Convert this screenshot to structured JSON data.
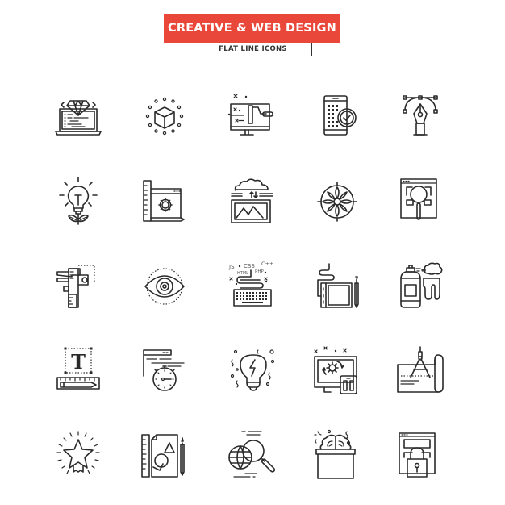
{
  "header": {
    "title": "CREATIVE & WEB DESIGN",
    "subtitle": "FLAT LINE ICONS",
    "accent_color": "#e8473a"
  },
  "icons": [
    {
      "name": "laptop-diamond-code-icon"
    },
    {
      "name": "cube-dots-icon"
    },
    {
      "name": "monitor-paint-roller-icon"
    },
    {
      "name": "phone-grid-check-icon"
    },
    {
      "name": "pen-tool-bezier-icon"
    },
    {
      "name": "lightbulb-plant-icon"
    },
    {
      "name": "ruler-window-gear-icon"
    },
    {
      "name": "cloud-image-sync-icon"
    },
    {
      "name": "compass-rose-icon"
    },
    {
      "name": "window-magnifier-icon"
    },
    {
      "name": "caliper-icon"
    },
    {
      "name": "eye-vision-icon"
    },
    {
      "name": "keyboard-code-languages-icon",
      "labels": [
        "JS",
        "CSS",
        "C++",
        "HTML",
        "PHP"
      ]
    },
    {
      "name": "graphic-tablet-pen-icon"
    },
    {
      "name": "spray-paint-can-icon"
    },
    {
      "name": "typography-ruler-icon",
      "glyph": "T"
    },
    {
      "name": "window-stopwatch-icon"
    },
    {
      "name": "idea-bulb-lightning-icon"
    },
    {
      "name": "responsive-devices-gear-icon"
    },
    {
      "name": "blueprint-compass-icon"
    },
    {
      "name": "star-badge-icon"
    },
    {
      "name": "sketch-shapes-pencil-icon"
    },
    {
      "name": "globe-search-icon"
    },
    {
      "name": "brain-box-icon"
    },
    {
      "name": "window-padlock-icon"
    }
  ]
}
